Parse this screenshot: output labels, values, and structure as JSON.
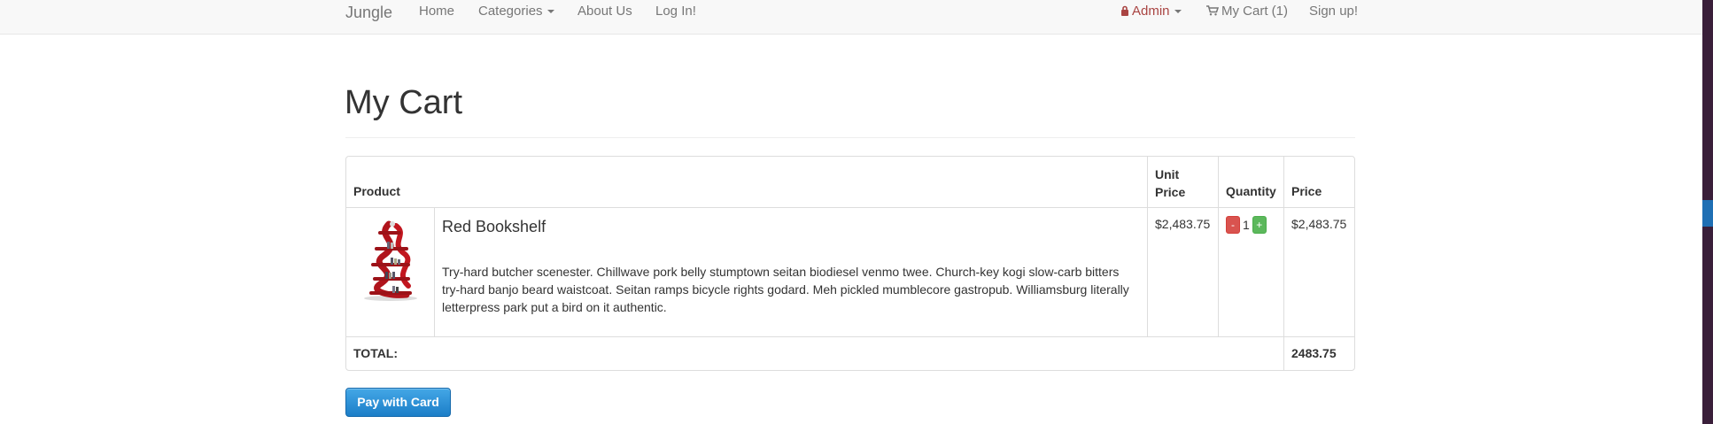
{
  "navbar": {
    "brand": "Jungle",
    "links": {
      "home": "Home",
      "categories": "Categories",
      "about": "About Us",
      "login": "Log In!"
    },
    "right": {
      "admin": "Admin",
      "cart": "My Cart (1)",
      "signup": "Sign up!"
    }
  },
  "page": {
    "title": "My Cart"
  },
  "table": {
    "headers": {
      "product": "Product",
      "unit_price_l1": "Unit",
      "unit_price_l2": "Price",
      "quantity": "Quantity",
      "price": "Price"
    },
    "items": [
      {
        "name": "Red Bookshelf",
        "description": "Try-hard butcher scenester. Chillwave pork belly stumptown seitan biodiesel venmo twee. Church-key kogi slow-carb bitters try-hard banjo beard waistcoat. Seitan ramps bicycle rights godard. Meh pickled mumblecore gastropub. Williamsburg literally letterpress park put a bird on it authentic.",
        "unit_price": "$2,483.75",
        "quantity": "1",
        "minus": "-",
        "plus": "+",
        "price": "$2,483.75"
      }
    ],
    "total_label": "TOTAL:",
    "total_value": "2483.75"
  },
  "pay_button": "Pay with Card",
  "colors": {
    "accent_red": "#a94442",
    "pay_blue": "#1b7ec8",
    "minus_red": "#d9534f",
    "plus_green": "#5cb85c"
  },
  "icons": {
    "lock": "lock-icon",
    "cart": "cart-icon",
    "caret": "caret-down-icon"
  }
}
